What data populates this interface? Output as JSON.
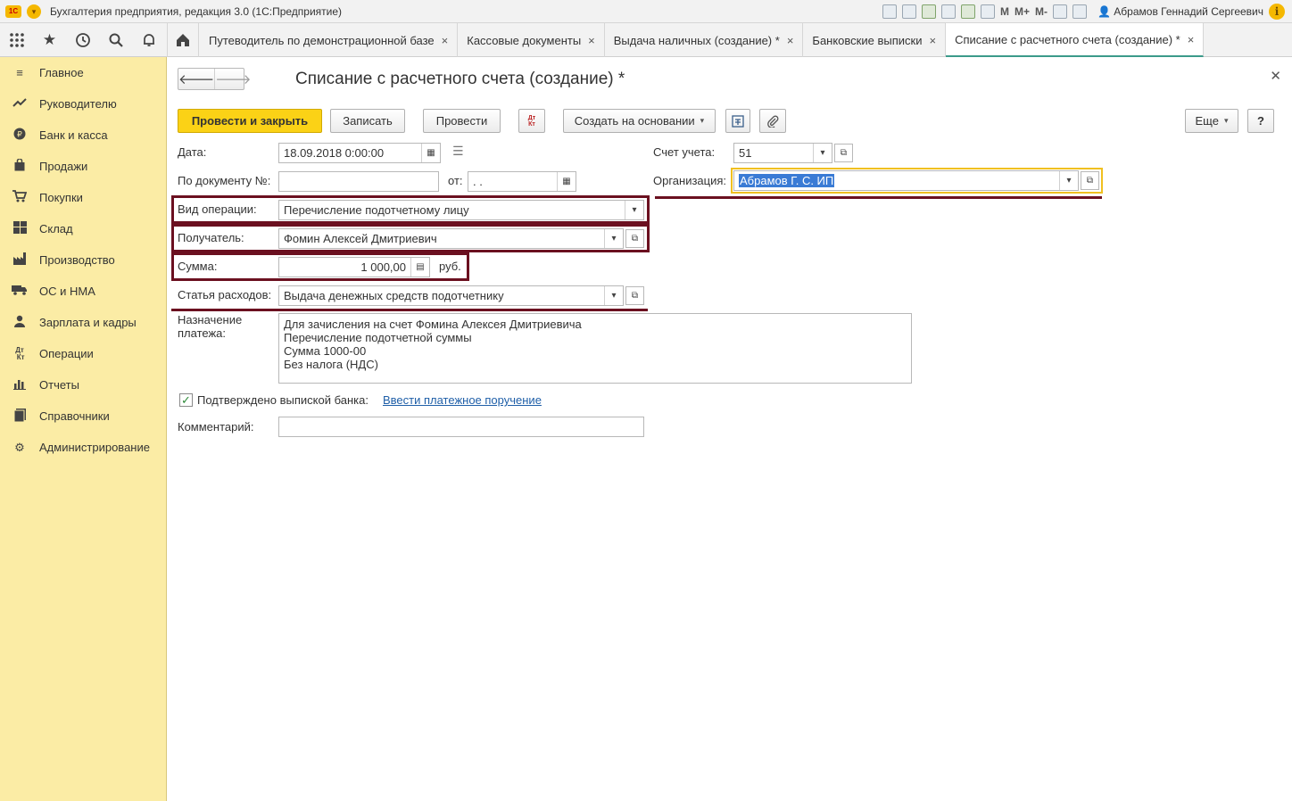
{
  "window": {
    "app_logo": "1С",
    "title": "Бухгалтерия предприятия, редакция 3.0  (1С:Предприятие)",
    "user": "Абрамов Геннадий Сергеевич",
    "memory_buttons": [
      "M",
      "M+",
      "M-"
    ],
    "info_label": "i"
  },
  "nav": {
    "tabs": [
      {
        "label": "Путеводитель по демонстрационной базе",
        "close": "×"
      },
      {
        "label": "Кассовые документы",
        "close": "×"
      },
      {
        "label": "Выдача наличных (создание) *",
        "close": "×"
      },
      {
        "label": "Банковские выписки",
        "close": "×"
      },
      {
        "label": "Списание с расчетного счета (создание) *",
        "close": "×",
        "active": true
      }
    ]
  },
  "sidebar": {
    "items": [
      {
        "label": "Главное",
        "icon": "menu-icon"
      },
      {
        "label": "Руководителю",
        "icon": "trend-icon"
      },
      {
        "label": "Банк и касса",
        "icon": "coin-icon"
      },
      {
        "label": "Продажи",
        "icon": "bag-icon"
      },
      {
        "label": "Покупки",
        "icon": "cart-icon"
      },
      {
        "label": "Склад",
        "icon": "warehouse-icon"
      },
      {
        "label": "Производство",
        "icon": "factory-icon"
      },
      {
        "label": "ОС и НМА",
        "icon": "truck-icon"
      },
      {
        "label": "Зарплата и кадры",
        "icon": "person-icon"
      },
      {
        "label": "Операции",
        "icon": "dtkt-icon"
      },
      {
        "label": "Отчеты",
        "icon": "barchart-icon"
      },
      {
        "label": "Справочники",
        "icon": "book-icon"
      },
      {
        "label": "Администрирование",
        "icon": "gear-icon"
      }
    ]
  },
  "doc": {
    "title": "Списание с расчетного счета (создание) *",
    "toolbar": {
      "post_close": "Провести и закрыть",
      "save": "Записать",
      "post": "Провести",
      "dtkt": "Дт Кт",
      "create_based": "Создать на основании",
      "more": "Еще",
      "help": "?"
    },
    "form": {
      "date_label": "Дата:",
      "date_value": "18.09.2018  0:00:00",
      "docnum_label": "По документу №:",
      "docnum_value": "",
      "from_label": "от:",
      "from_value": " .  .",
      "account_label": "Счет учета:",
      "account_value": "51",
      "org_label": "Организация:",
      "org_value": "Абрамов Г. С. ИП",
      "op_label": "Вид операции:",
      "op_value": "Перечисление подотчетному лицу",
      "recipient_label": "Получатель:",
      "recipient_value": "Фомин Алексей Дмитриевич",
      "sum_label": "Сумма:",
      "sum_value": "1 000,00",
      "currency": "руб.",
      "expense_label": "Статья расходов:",
      "expense_value": "Выдача денежных средств подотчетнику",
      "purpose_label_1": "Назначение",
      "purpose_label_2": "платежа:",
      "purpose_lines": [
        "Для зачисления на счет Фомина Алексея Дмитриевича",
        "Перечисление подотчетной суммы",
        "Сумма 1000-00",
        "Без налога (НДС)"
      ],
      "confirmed_label": "Подтверждено выпиской банка:",
      "confirmed_checked": true,
      "payment_order_link": "Ввести платежное поручение",
      "comment_label": "Комментарий:",
      "comment_value": ""
    }
  }
}
